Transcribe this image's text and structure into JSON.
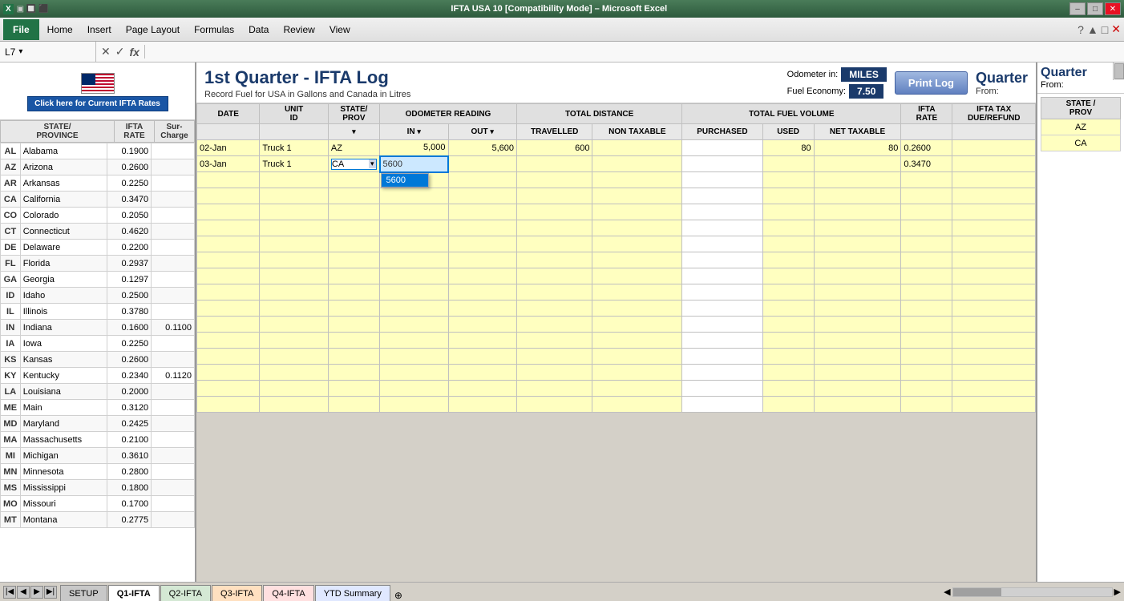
{
  "titlebar": {
    "title": "IFTA USA 10  [Compatibility Mode]  –  Microsoft Excel",
    "minimize": "–",
    "maximize": "□",
    "close": "✕"
  },
  "menubar": {
    "file": "File",
    "home": "Home",
    "insert": "Insert",
    "page_layout": "Page Layout",
    "formulas": "Formulas",
    "data": "Data",
    "review": "Review",
    "view": "View"
  },
  "formula_bar": {
    "cell_ref": "L7",
    "formula": ""
  },
  "header": {
    "ifta_link": "Click here for Current IFTA Rates",
    "quarter_title": "1st Quarter - IFTA Log",
    "subtitle": "Record Fuel for USA in Gallons and Canada in Litres",
    "odometer_label": "Odometer in:",
    "odometer_value": "MILES",
    "fuel_economy_label": "Fuel Economy:",
    "fuel_economy_value": "7.50",
    "print_btn": "Print Log",
    "quarter_right": "Quarter",
    "quarter_from": "From:"
  },
  "states": [
    {
      "abbr": "AL",
      "name": "Alabama",
      "rate": "0.1900",
      "surcharge": ""
    },
    {
      "abbr": "AZ",
      "name": "Arizona",
      "rate": "0.2600",
      "surcharge": ""
    },
    {
      "abbr": "AR",
      "name": "Arkansas",
      "rate": "0.2250",
      "surcharge": ""
    },
    {
      "abbr": "CA",
      "name": "California",
      "rate": "0.3470",
      "surcharge": ""
    },
    {
      "abbr": "CO",
      "name": "Colorado",
      "rate": "0.2050",
      "surcharge": ""
    },
    {
      "abbr": "CT",
      "name": "Connecticut",
      "rate": "0.4620",
      "surcharge": ""
    },
    {
      "abbr": "DE",
      "name": "Delaware",
      "rate": "0.2200",
      "surcharge": ""
    },
    {
      "abbr": "FL",
      "name": "Florida",
      "rate": "0.2937",
      "surcharge": ""
    },
    {
      "abbr": "GA",
      "name": "Georgia",
      "rate": "0.1297",
      "surcharge": ""
    },
    {
      "abbr": "ID",
      "name": "Idaho",
      "rate": "0.2500",
      "surcharge": ""
    },
    {
      "abbr": "IL",
      "name": "Illinois",
      "rate": "0.3780",
      "surcharge": ""
    },
    {
      "abbr": "IN",
      "name": "Indiana",
      "rate": "0.1600",
      "surcharge": "0.1100"
    },
    {
      "abbr": "IA",
      "name": "Iowa",
      "rate": "0.2250",
      "surcharge": ""
    },
    {
      "abbr": "KS",
      "name": "Kansas",
      "rate": "0.2600",
      "surcharge": ""
    },
    {
      "abbr": "KY",
      "name": "Kentucky",
      "rate": "0.2340",
      "surcharge": "0.1120"
    },
    {
      "abbr": "LA",
      "name": "Louisiana",
      "rate": "0.2000",
      "surcharge": ""
    },
    {
      "abbr": "ME",
      "name": "Main",
      "rate": "0.3120",
      "surcharge": ""
    },
    {
      "abbr": "MD",
      "name": "Maryland",
      "rate": "0.2425",
      "surcharge": ""
    },
    {
      "abbr": "MA",
      "name": "Massachusetts",
      "rate": "0.2100",
      "surcharge": ""
    },
    {
      "abbr": "MI",
      "name": "Michigan",
      "rate": "0.3610",
      "surcharge": ""
    },
    {
      "abbr": "MN",
      "name": "Minnesota",
      "rate": "0.2800",
      "surcharge": ""
    },
    {
      "abbr": "MS",
      "name": "Mississippi",
      "rate": "0.1800",
      "surcharge": ""
    },
    {
      "abbr": "MO",
      "name": "Missouri",
      "rate": "0.1700",
      "surcharge": ""
    },
    {
      "abbr": "MT",
      "name": "Montana",
      "rate": "0.2775",
      "surcharge": ""
    }
  ],
  "col_headers": {
    "state_province": "STATE/\nPROVINCE",
    "ifta_rate": "IFTA\nRATE",
    "surcharge": "Sur-\nCharge",
    "date": "DATE",
    "unit_id": "UNIT\nID",
    "state_prov": "STATE/\nPROV",
    "odo_in": "IN",
    "odo_out": "OUT",
    "total_dist": "TOTAL DISTANCE",
    "travelled": "TOTAL DISTANCE\nTRAVELLED",
    "non_taxable": "NON TAXABLE",
    "purchased": "PURCHASED",
    "used": "USED",
    "net_taxable": "NET TAXABLE",
    "ifta_rate_col": "IFTA\nRATE",
    "ifta_tax": "IFTA TAX\nDUE/REFUND",
    "odo_reading": "ODOMETER READING"
  },
  "log_data": [
    {
      "date": "02-Jan",
      "unit_id": "Truck 1",
      "state_prov": "AZ",
      "odo_in": "5,000",
      "odo_out": "5,600",
      "travelled": "600",
      "non_taxable": "",
      "purchased": "",
      "used": "80",
      "net_taxable": "80",
      "ifta_rate": "0.2600",
      "ifta_tax": ""
    },
    {
      "date": "03-Jan",
      "unit_id": "Truck 1",
      "state_prov": "CA",
      "odo_in": "5600",
      "odo_in_typing": true,
      "odo_out": "",
      "travelled": "",
      "non_taxable": "",
      "purchased": "",
      "used": "",
      "net_taxable": "",
      "ifta_rate": "0.3470",
      "ifta_tax": ""
    }
  ],
  "quarter_right": {
    "title": "Quarter",
    "from_label": "From:",
    "states": [
      "AZ",
      "CA"
    ]
  },
  "sheet_tabs": [
    {
      "name": "SETUP",
      "active": false,
      "style": "normal"
    },
    {
      "name": "Q1-IFTA",
      "active": true,
      "style": "normal"
    },
    {
      "name": "Q2-IFTA",
      "active": false,
      "style": "q2"
    },
    {
      "name": "Q3-IFTA",
      "active": false,
      "style": "q3"
    },
    {
      "name": "Q4-IFTA",
      "active": false,
      "style": "q4"
    },
    {
      "name": "YTD Summary",
      "active": false,
      "style": "ytd"
    }
  ]
}
